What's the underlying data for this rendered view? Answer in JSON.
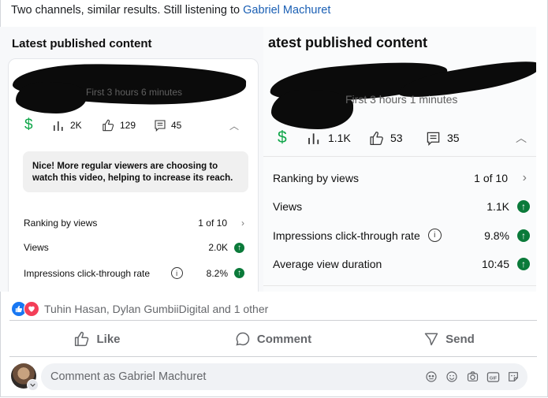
{
  "post": {
    "text_prefix": "Two channels, similar results. Still listening to ",
    "text_link": "Gabriel Machuret"
  },
  "left_panel": {
    "section_title": "Latest published content",
    "first_hours": "First 3 hours 6 minutes",
    "views": "2K",
    "likes": "129",
    "comments": "45",
    "note": "Nice! More regular viewers are choosing to watch this video, helping to increase its reach.",
    "metrics": [
      {
        "name": "Ranking by views",
        "value": "1 of 10"
      },
      {
        "name": "Views",
        "value": "2.0K"
      },
      {
        "name": "Impressions click-through rate",
        "value": "8.2%"
      }
    ]
  },
  "right_panel": {
    "section_title": "atest published content",
    "first_hours": "First 3 hours 1 minutes",
    "views": "1.1K",
    "likes": "53",
    "comments": "35",
    "metrics": [
      {
        "name": "Ranking by views",
        "value": "1 of 10"
      },
      {
        "name": "Views",
        "value": "1.1K"
      },
      {
        "name": "Impressions click-through rate",
        "value": "9.8%"
      },
      {
        "name": "Average view duration",
        "value": "10:45"
      }
    ]
  },
  "reactions": {
    "text": "Tuhin Hasan, Dylan GumbiiDigital and 1 other",
    "icons": [
      "like-icon",
      "love-icon"
    ]
  },
  "actions": {
    "like": "Like",
    "comment": "Comment",
    "send": "Send"
  },
  "composer": {
    "placeholder": "Comment as Gabriel Machuret",
    "icons": [
      "avatar-sticker-icon",
      "emoji-icon",
      "camera-icon",
      "gif-icon",
      "sticker-icon"
    ]
  },
  "colors": {
    "link": "#1a5fb4",
    "up_arrow": "#0b7a3a",
    "dollar": "#10a64a",
    "like": "#1877f2",
    "love": "#f33e58"
  }
}
